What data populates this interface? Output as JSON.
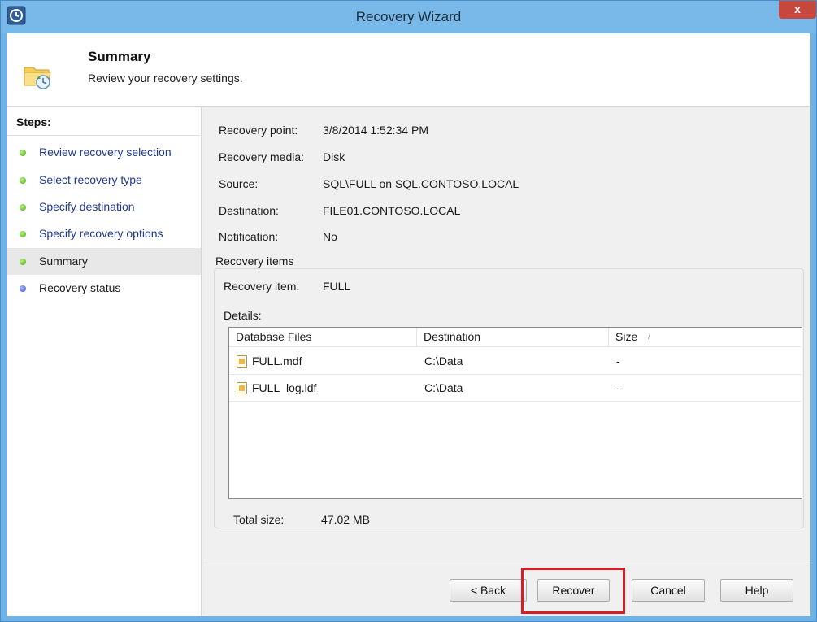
{
  "window": {
    "title": "Recovery Wizard",
    "close_label": "x"
  },
  "header": {
    "title": "Summary",
    "subtitle": "Review your recovery settings."
  },
  "steps": {
    "title": "Steps:",
    "items": [
      {
        "label": "Review recovery selection",
        "status": "complete",
        "color": "#4aa71b"
      },
      {
        "label": "Select recovery type",
        "status": "complete",
        "color": "#4aa71b"
      },
      {
        "label": "Specify destination",
        "status": "complete",
        "color": "#4aa71b"
      },
      {
        "label": "Specify recovery options",
        "status": "complete",
        "color": "#4aa71b"
      },
      {
        "label": "Summary",
        "status": "current",
        "color": "#4aa71b"
      },
      {
        "label": "Recovery status",
        "status": "pending",
        "color": "#3a4fc9"
      }
    ]
  },
  "summary": {
    "fields": [
      {
        "label": "Recovery point:",
        "value": "3/8/2014 1:52:34 PM"
      },
      {
        "label": "Recovery media:",
        "value": "Disk"
      },
      {
        "label": "Source:",
        "value": "SQL\\FULL on SQL.CONTOSO.LOCAL"
      },
      {
        "label": "Destination:",
        "value": "FILE01.CONTOSO.LOCAL"
      },
      {
        "label": "Notification:",
        "value": "No"
      }
    ],
    "recovery_items": {
      "legend": "Recovery items",
      "item_label": "Recovery item:",
      "item_value": "FULL",
      "details_label": "Details:",
      "columns": [
        "Database Files",
        "Destination",
        "Size"
      ],
      "sort_indicator": "/",
      "rows": [
        {
          "file": "FULL.mdf",
          "destination": "C:\\Data",
          "size": "-"
        },
        {
          "file": "FULL_log.ldf",
          "destination": "C:\\Data",
          "size": "-"
        }
      ],
      "total_label": "Total size:",
      "total_value": "47.02 MB"
    }
  },
  "footer": {
    "back": "< Back",
    "recover": "Recover",
    "cancel": "Cancel",
    "help": "Help",
    "highlight_color": "#d81c28"
  }
}
